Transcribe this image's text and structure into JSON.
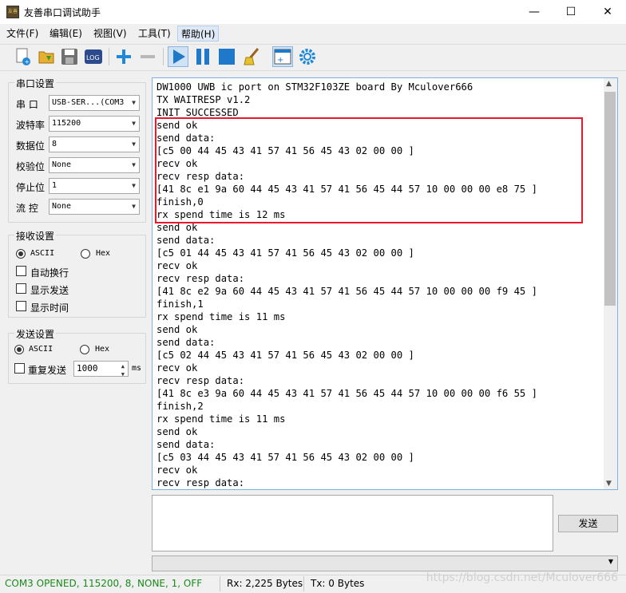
{
  "window": {
    "title": "友善串口调试助手",
    "app_icon_text": "友善",
    "minimize_glyph": "—",
    "maximize_glyph": "☐",
    "close_glyph": "✕"
  },
  "menu": {
    "file": "文件(F)",
    "edit": "编辑(E)",
    "view": "视图(V)",
    "tools": "工具(T)",
    "help": "帮助(H)"
  },
  "toolbar": {
    "log_label": "LOG",
    "icons": [
      "new-icon",
      "open-icon",
      "save-icon",
      "log-icon",
      "add-icon",
      "remove-icon",
      "play-icon",
      "pause-icon",
      "stop-icon",
      "clear-icon",
      "window-icon",
      "settings-icon"
    ]
  },
  "serial_settings": {
    "title": "串口设置",
    "port_label": "串  口",
    "port_value": "USB-SER...(COM3",
    "baud_label": "波特率",
    "baud_value": "115200",
    "databits_label": "数据位",
    "databits_value": "8",
    "parity_label": "校验位",
    "parity_value": "None",
    "stopbits_label": "停止位",
    "stopbits_value": "1",
    "flow_label": "流  控",
    "flow_value": "None"
  },
  "receive_settings": {
    "title": "接收设置",
    "ascii_label": "ASCII",
    "hex_label": "Hex",
    "auto_wrap_label": "自动换行",
    "show_send_label": "显示发送",
    "show_time_label": "显示时间"
  },
  "send_settings": {
    "title": "发送设置",
    "ascii_label": "ASCII",
    "hex_label": "Hex",
    "repeat_label": "重复发送",
    "interval_value": "1000",
    "interval_unit": "ms"
  },
  "console": {
    "lines": [
      "DW1000 UWB ic port on STM32F103ZE board By Mculover666",
      "TX WAITRESP v1.2",
      "INIT SUCCESSED",
      "send ok",
      "send data:",
      "[c5 00 44 45 43 41 57 41 56 45 43 02 00 00 ]",
      "recv ok",
      "recv resp data:",
      "[41 8c e1 9a 60 44 45 43 41 57 41 56 45 44 57 10 00 00 00 e8 75 ]",
      "finish,0",
      "rx spend time is 12 ms",
      "send ok",
      "send data:",
      "[c5 01 44 45 43 41 57 41 56 45 43 02 00 00 ]",
      "recv ok",
      "recv resp data:",
      "[41 8c e2 9a 60 44 45 43 41 57 41 56 45 44 57 10 00 00 00 f9 45 ]",
      "finish,1",
      "rx spend time is 11 ms",
      "send ok",
      "send data:",
      "[c5 02 44 45 43 41 57 41 56 45 43 02 00 00 ]",
      "recv ok",
      "recv resp data:",
      "[41 8c e3 9a 60 44 45 43 41 57 41 56 45 44 57 10 00 00 00 f6 55 ]",
      "finish,2",
      "rx spend time is 11 ms",
      "send ok",
      "send data:",
      "[c5 03 44 45 43 41 57 41 56 45 43 02 00 00 ]",
      "recv ok",
      "recv resp data:"
    ]
  },
  "send_area": {
    "send_button": "发送"
  },
  "status": {
    "connection": "COM3 OPENED, 115200, 8, NONE, 1, OFF",
    "rx": "Rx: 2,225 Bytes",
    "tx": "Tx: 0 Bytes",
    "watermark": "https://blog.csdn.net/Mculover666",
    "connection_color": "#1a8a1a",
    "highlight_color": "#e8192c"
  }
}
